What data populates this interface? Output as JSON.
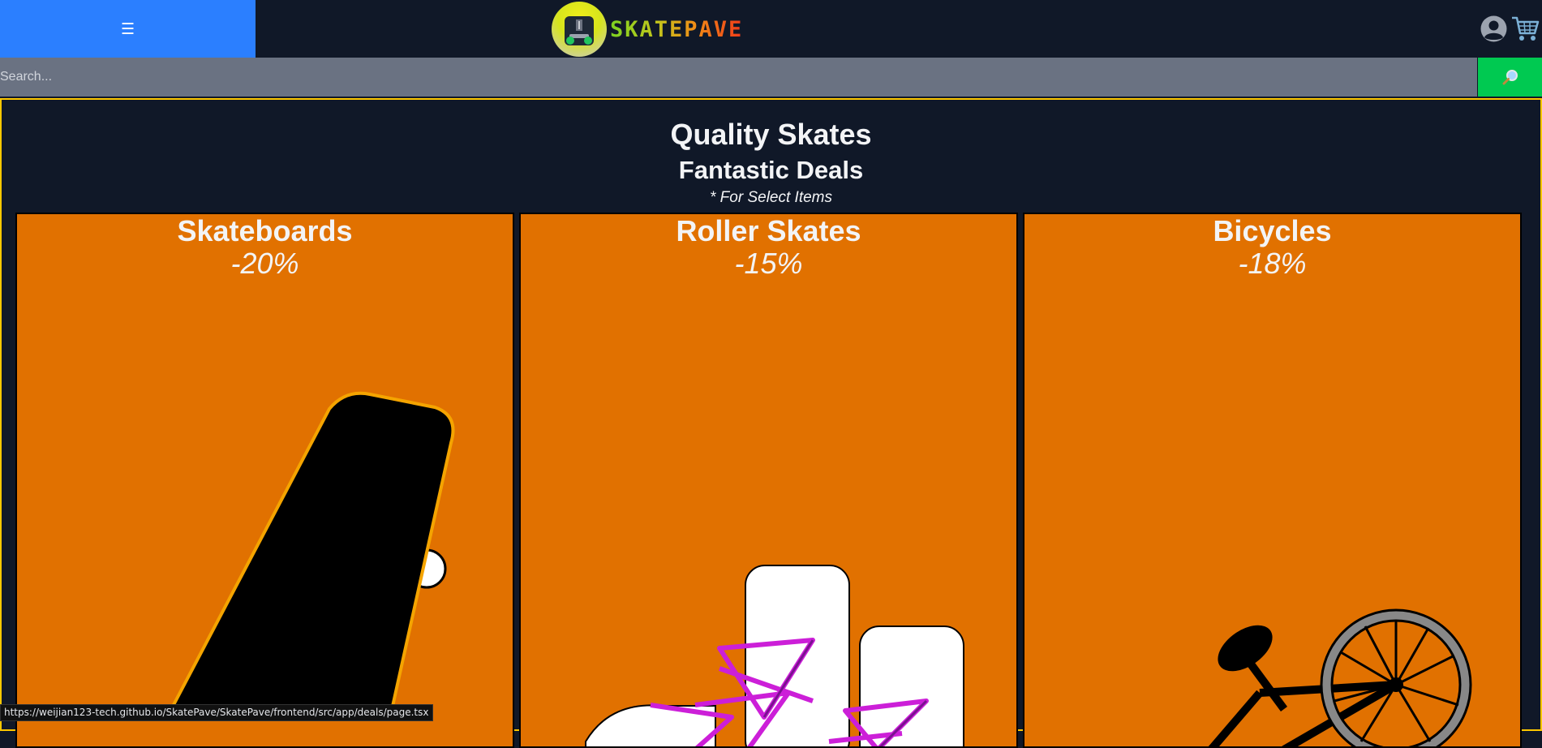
{
  "header": {
    "menu_icon": "☰",
    "brand": "SKATEPAVE"
  },
  "search": {
    "placeholder": "Search...",
    "button_icon": "magnifier-icon"
  },
  "hero": {
    "title": "Quality Skates",
    "subtitle": "Fantastic Deals",
    "note": "* For Select Items"
  },
  "deals": [
    {
      "title": "Skateboards",
      "discount": "-20%"
    },
    {
      "title": "Roller Skates",
      "discount": "-15%"
    },
    {
      "title": "Bicycles",
      "discount": "-18%"
    }
  ],
  "status_bar": {
    "url": "https://weijian123-tech.github.io/SkatePave/SkatePave/frontend/src/app/deals/page.tsx"
  },
  "colors": {
    "menu_bg": "#2b7fff",
    "page_bg": "#101828",
    "search_bg": "#6a7282",
    "search_btn": "#00c951",
    "card_bg": "#e17100",
    "frame_border": "#fdc700"
  }
}
